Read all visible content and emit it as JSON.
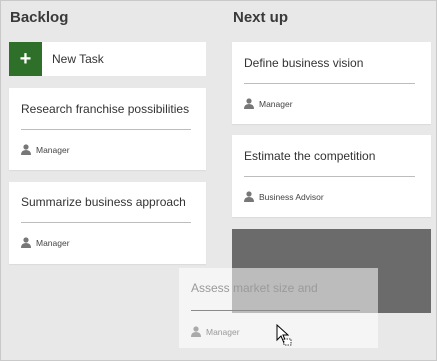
{
  "columns": {
    "backlog": {
      "title": "Backlog"
    },
    "next_up": {
      "title": "Next up"
    }
  },
  "new_task": {
    "label": "New Task",
    "icon": "plus-icon"
  },
  "backlog_cards": [
    {
      "title": "Research franchise possibilities",
      "assignee": "Manager"
    },
    {
      "title": "Summarize business approach",
      "assignee": "Manager"
    }
  ],
  "next_up_cards": [
    {
      "title": "Define business vision",
      "assignee": "Manager"
    },
    {
      "title": "Estimate the competition",
      "assignee": "Business Advisor"
    }
  ],
  "dragged_card": {
    "title": "Assess market size and",
    "assignee": "Manager"
  },
  "colors": {
    "accent": "#2e6f2a",
    "board_bg": "#e8e8e8",
    "drop_placeholder": "#6b6b6b"
  }
}
